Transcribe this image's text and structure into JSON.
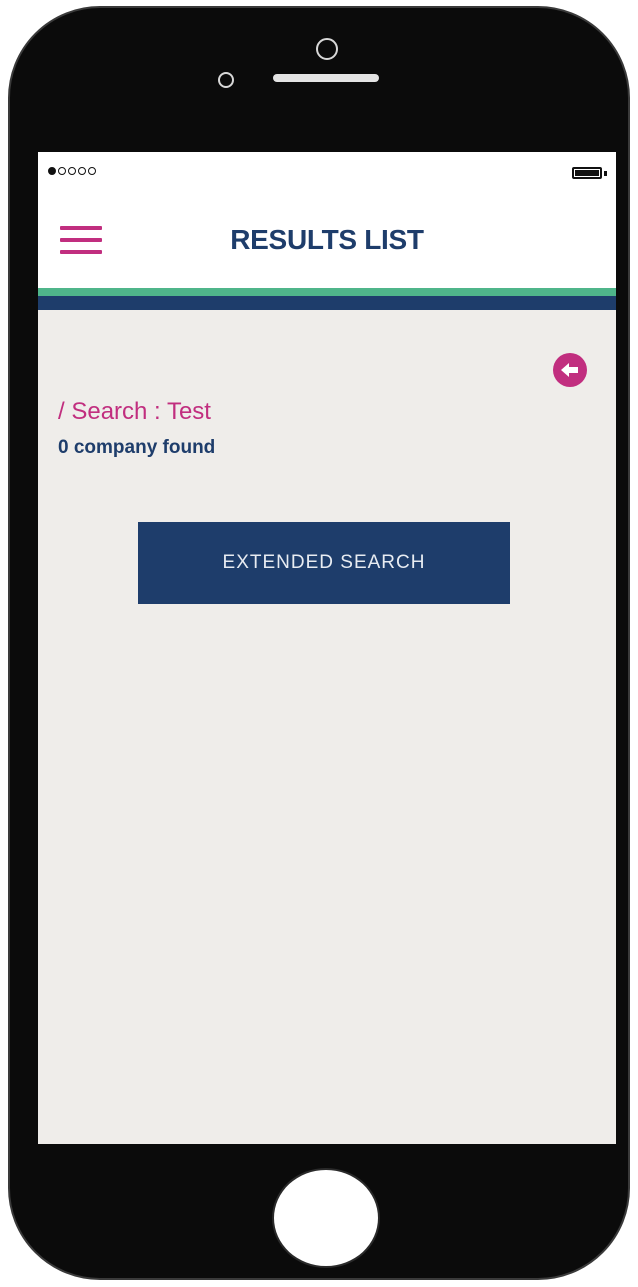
{
  "status_bar": {
    "signal_filled": 1,
    "signal_total": 5,
    "battery_level": 1.0
  },
  "header": {
    "title": "RESULTS LIST",
    "menu_icon": "hamburger-menu-icon"
  },
  "main": {
    "back_icon": "arrow-left-circle-icon",
    "search_heading": "/ Search : Test",
    "result_count": "0 company found",
    "extended_search_label": "EXTENDED SEARCH"
  },
  "colors": {
    "accent_pink": "#c12e7f",
    "brand_navy": "#1e3d6b",
    "stripe_green": "#4fb58a",
    "screen_background": "#efedea"
  }
}
